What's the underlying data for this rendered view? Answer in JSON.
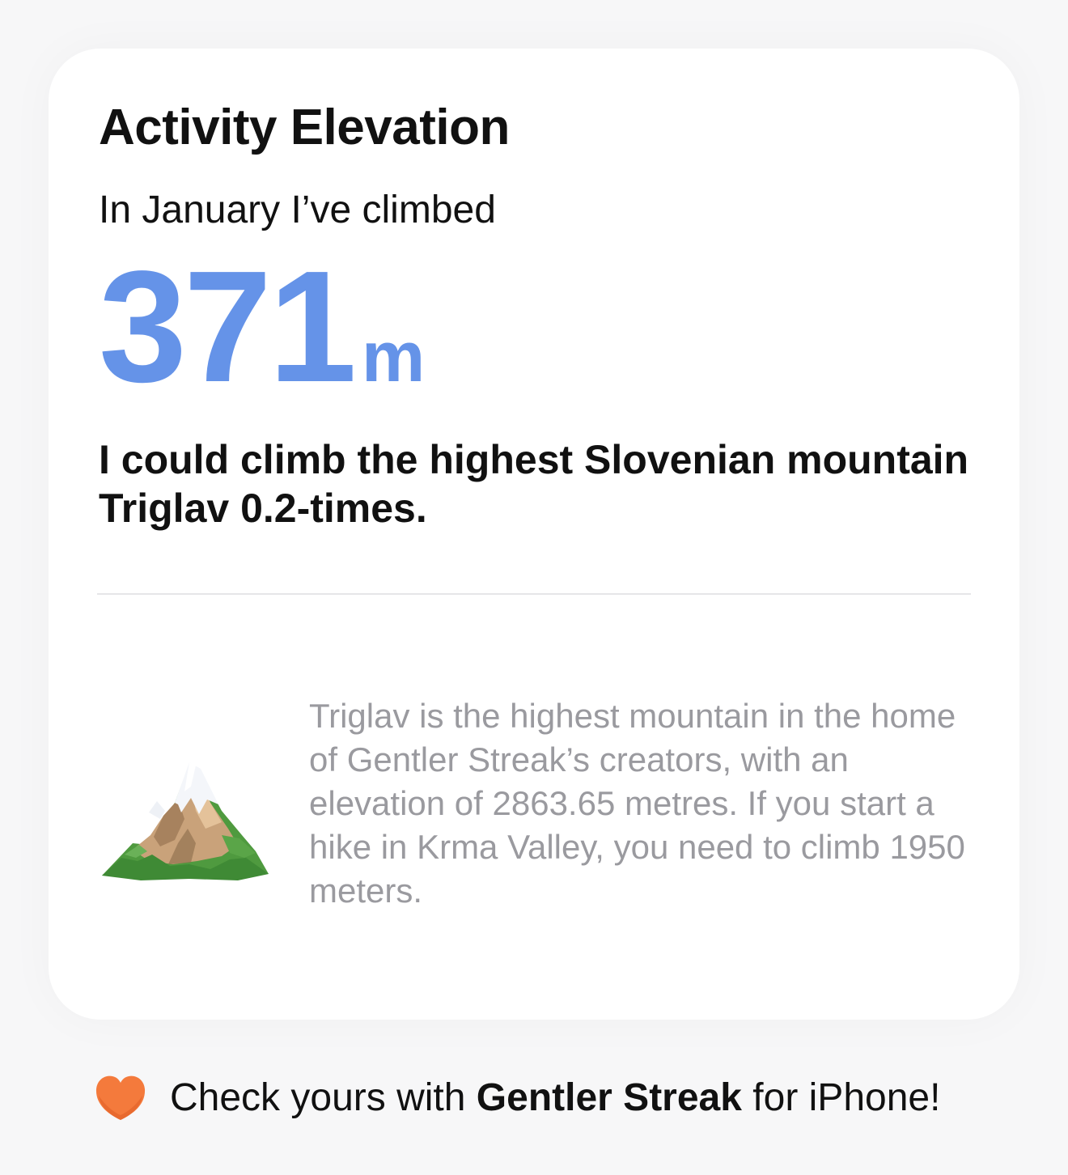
{
  "card": {
    "title": "Activity Elevation",
    "subtitle": "In January I’ve climbed",
    "stat": {
      "value": "371",
      "unit": "m",
      "color": "#6593e8"
    },
    "comparison": "I could climb the highest Slovenian mountain Triglav 0.2-times.",
    "fact_icon": "mountain-icon",
    "fact": "Triglav is the highest mountain in the home of Gentler Streak’s creators, with an elevation of 2863.65 metres. If you start a hike in Krma Valley, you need to climb 1950 meters."
  },
  "footer": {
    "icon": "heart-icon",
    "prefix": "Check yours with ",
    "brand": "Gentler Streak",
    "suffix": " for iPhone!",
    "icon_color": "#f47a3c"
  }
}
